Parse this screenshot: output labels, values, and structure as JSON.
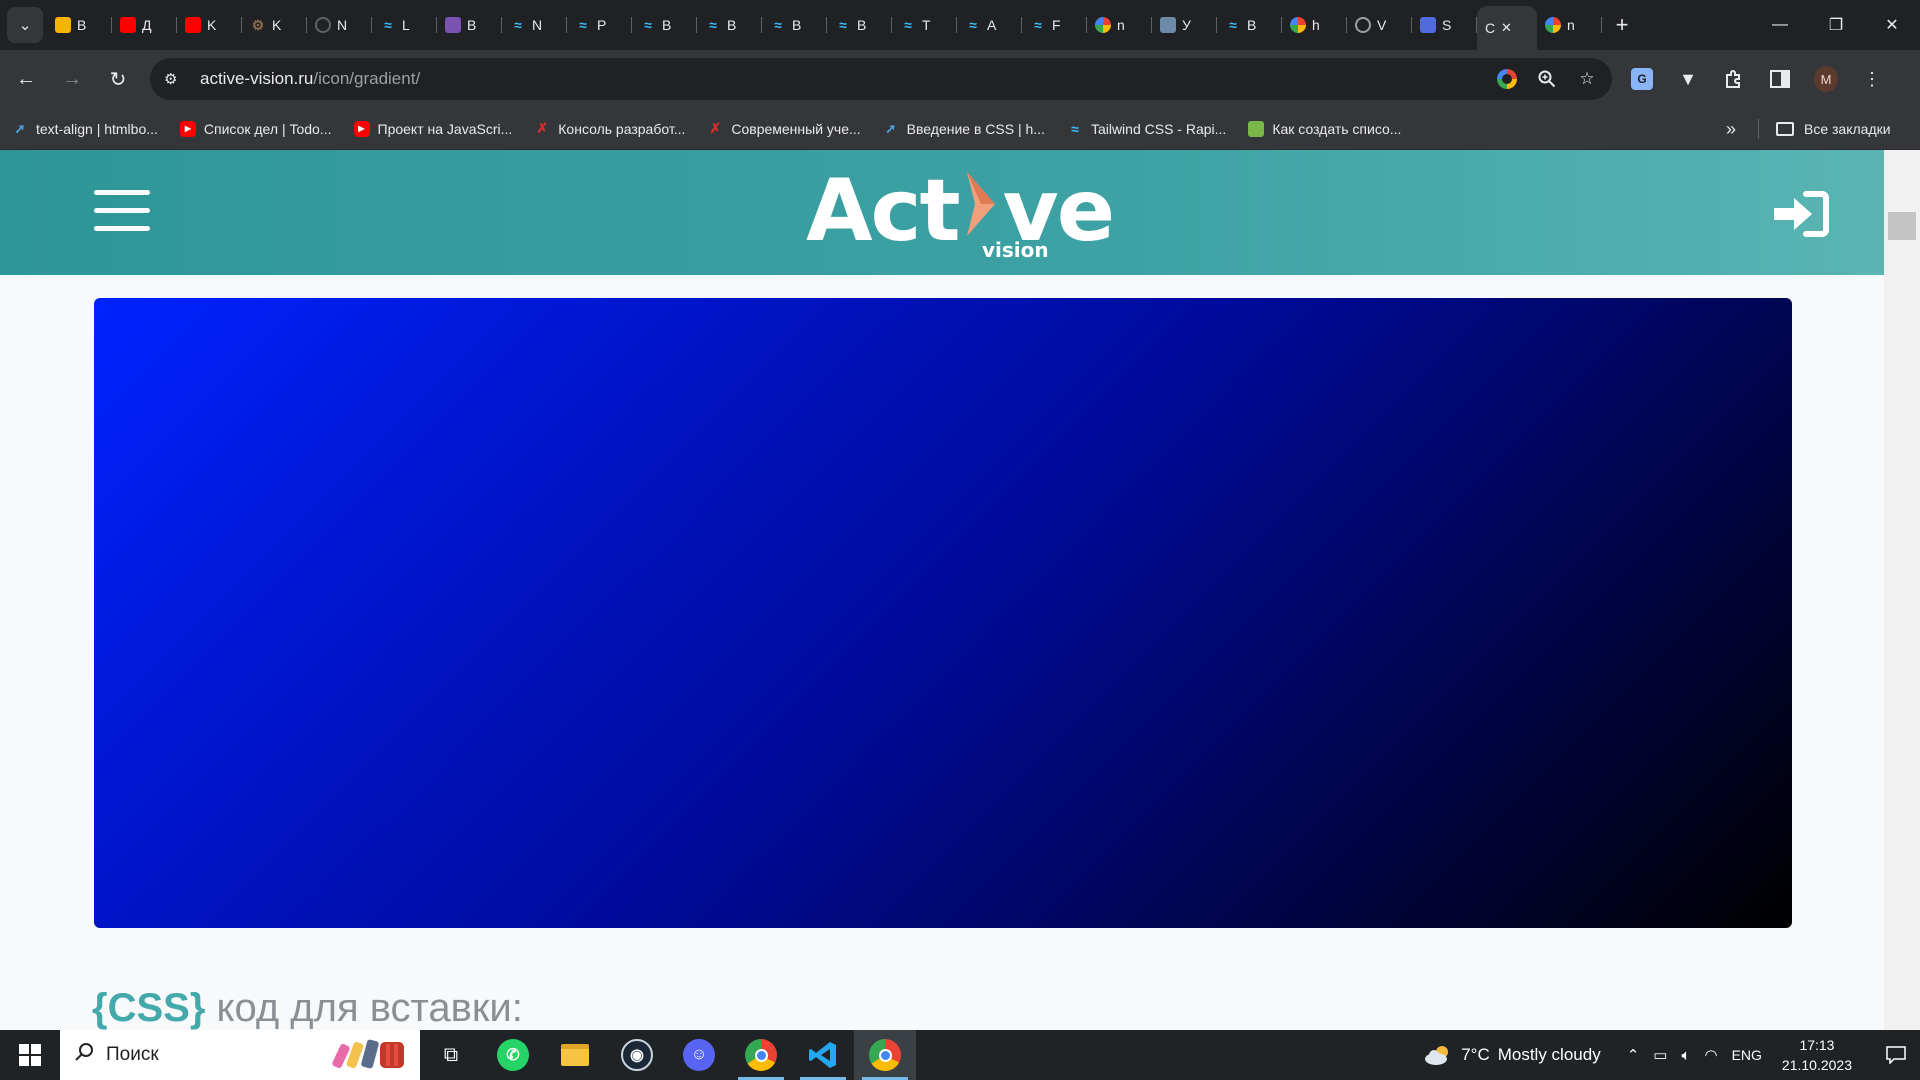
{
  "browser": {
    "tabs": [
      {
        "letter": "B",
        "favicon": "google-drive-icon",
        "color": "#f4b400"
      },
      {
        "letter": "Д",
        "favicon": "youtube-icon",
        "color": "#ff0000"
      },
      {
        "letter": "K",
        "favicon": "youtube-icon",
        "color": "#ff0000"
      },
      {
        "letter": "K",
        "favicon": "gear-icon",
        "color": "#8a6a4a"
      },
      {
        "letter": "N",
        "favicon": "github-icon",
        "color": "#3c3c3c"
      },
      {
        "letter": "L",
        "favicon": "tailwind-icon",
        "color": "#38bdf8"
      },
      {
        "letter": "B",
        "favicon": "bootstrap-icon",
        "color": "#7952b3"
      },
      {
        "letter": "N",
        "favicon": "tailwind-icon",
        "color": "#38bdf8"
      },
      {
        "letter": "P",
        "favicon": "tailwind-icon",
        "color": "#38bdf8"
      },
      {
        "letter": "B",
        "favicon": "tailwind-icon",
        "color": "#38bdf8"
      },
      {
        "letter": "B",
        "favicon": "tailwind-icon",
        "color": "#38bdf8"
      },
      {
        "letter": "B",
        "favicon": "tailwind-icon",
        "color": "#38bdf8"
      },
      {
        "letter": "B",
        "favicon": "tailwind-icon",
        "color": "#38bdf8"
      },
      {
        "letter": "T",
        "favicon": "tailwind-icon",
        "color": "#38bdf8"
      },
      {
        "letter": "A",
        "favicon": "tailwind-icon",
        "color": "#38bdf8"
      },
      {
        "letter": "F",
        "favicon": "tailwind-icon",
        "color": "#38bdf8"
      },
      {
        "letter": "n",
        "favicon": "google-icon",
        "color": "#ffffff"
      },
      {
        "letter": "У",
        "favicon": "css-icon",
        "color": "#6d8ba8"
      },
      {
        "letter": "B",
        "favicon": "tailwind-icon",
        "color": "#38bdf8"
      },
      {
        "letter": "h",
        "favicon": "google-icon",
        "color": "#ffffff"
      },
      {
        "letter": "V",
        "favicon": "globe-icon",
        "color": "#5f6368"
      },
      {
        "letter": "S",
        "favicon": "tool-icon",
        "color": "#4f6bdc"
      }
    ],
    "active_tab": {
      "letter": "C"
    },
    "last_tab": {
      "letter": "n"
    },
    "url_host": "active-vision.ru",
    "url_path": "/icon/gradient/",
    "profile_initial": "M",
    "bookmarks": [
      {
        "label": "text-align | htmlbo...",
        "icon": "htmlbook-icon",
        "color": "#4aa3df"
      },
      {
        "label": "Список дел | Todo...",
        "icon": "youtube-icon",
        "color": "#ff0000"
      },
      {
        "label": "Проект на JavaScri...",
        "icon": "youtube-icon",
        "color": "#ff0000"
      },
      {
        "label": "Консоль разработ...",
        "icon": "javascript-info-icon",
        "color": "#d52e2e"
      },
      {
        "label": "Современный уче...",
        "icon": "javascript-info-icon",
        "color": "#d52e2e"
      },
      {
        "label": "Введение в CSS | h...",
        "icon": "htmlbook-icon",
        "color": "#4aa3df"
      },
      {
        "label": "Tailwind CSS - Rapi...",
        "icon": "tailwind-icon",
        "color": "#38bdf8"
      },
      {
        "label": "Как создать списо...",
        "icon": "image-icon",
        "color": "#7ab648"
      }
    ],
    "all_bookmarks_label": "Все закладки"
  },
  "site": {
    "logo_main_left": "Act",
    "logo_main_right": "ve",
    "logo_sub": "vision",
    "brand_color": "#3ea2a4",
    "accent_color": "#f2a07b"
  },
  "gradient": {
    "color_start": "#0022ff",
    "color_mid": "#000a99",
    "color_end": "#000000"
  },
  "code_section": {
    "tag": "{CSS}",
    "heading": " код для вставки:"
  },
  "taskbar": {
    "search_placeholder": "Поиск",
    "apps": [
      "task-view-icon",
      "whatsapp-icon",
      "file-explorer-icon",
      "steam-icon",
      "discord-icon",
      "chrome-icon",
      "vscode-icon",
      "chrome-profile-icon"
    ],
    "weather_temp": "7°C",
    "weather_text": "Mostly cloudy",
    "language": "ENG",
    "time": "17:13",
    "date": "21.10.2023"
  }
}
